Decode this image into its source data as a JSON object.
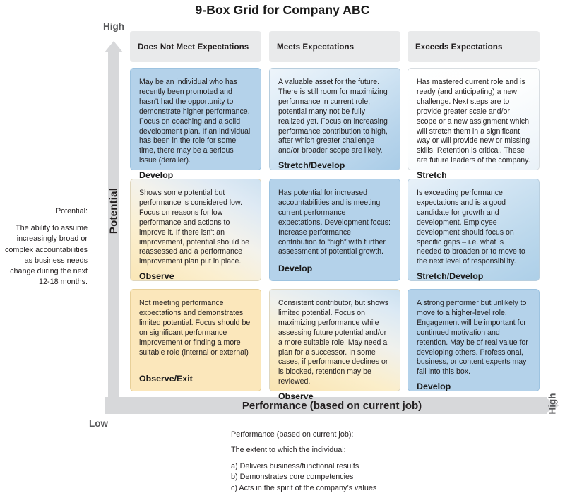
{
  "title": "9-Box Grid for Company ABC",
  "axes": {
    "vertical": {
      "label": "Potential",
      "high_label": "High",
      "low_label": "Low",
      "description_title": "Potential:",
      "description_body": "The ability to assume increasingly broad or complex accountabilities as business needs change during the next 12-18 months."
    },
    "horizontal": {
      "label": "Performance (based on current job)",
      "high_label": "High"
    }
  },
  "column_headers": [
    "Does Not Meet Expectations",
    "Meets Expectations",
    "Exceeds Expectations"
  ],
  "cells": [
    {
      "row": 0,
      "col": 0,
      "body": "May be an individual who has recently been promoted and hasn't had the opportunity to demonstrate higher performance. Focus on coaching and a solid development plan. If an individual has been in the role for some time, there may be a serious issue (derailer).",
      "action": "Develop",
      "fill": "#b4d2ea"
    },
    {
      "row": 0,
      "col": 1,
      "body": "A valuable asset for the future. There is still room for maximizing performance in current role; potential many not be fully realized yet. Focus on increasing performance contribution to high, after which greater challenge and/or broader scope are likely.",
      "action": "Stretch/Develop",
      "fill": "#d7e8f5"
    },
    {
      "row": 0,
      "col": 2,
      "body": "Has mastered current role and is ready (and anticipating) a new challenge. Next steps are to provide greater scale and/or scope or a new assignment which will stretch them in a significant way or will provide new or missing skills. Retention is critical. These are future leaders of the company.",
      "action": "Stretch",
      "fill": "#fdfefe"
    },
    {
      "row": 1,
      "col": 0,
      "body": "Shows some potential but performance is considered low. Focus on reasons for low performance and actions to improve it. If there isn't an improvement, potential should be reassessed and a performance improvement plan put in place.",
      "action": "Observe",
      "fill": "#f5ead0"
    },
    {
      "row": 1,
      "col": 1,
      "body": "Has potential for increased accountabilities and is meeting current performance expectations. Development focus: Increase performance contribution to “high” with further assessment of potential growth.",
      "action": "Develop",
      "fill": "#b4d2ea"
    },
    {
      "row": 1,
      "col": 2,
      "body": "Is exceeding performance expectations and is a good candidate for growth and development. Employee development should focus on specific gaps – i.e. what is needed to broaden or to move to the next level of responsibility.",
      "action": "Stretch/Develop",
      "fill": "#d4e6f4"
    },
    {
      "row": 2,
      "col": 0,
      "body": "Not meeting performance expectations and demonstrates limited potential. Focus should be on significant performance improvement or finding a more suitable role (internal or external)",
      "action": "Observe/Exit",
      "fill": "#fbe7bb"
    },
    {
      "row": 2,
      "col": 1,
      "body": "Consistent contributor, but shows limited potential. Focus on maximizing performance while assessing future potential and/or a more suitable role. May need a plan for a successor. In some cases, if performance declines or is blocked, retention may be reviewed.",
      "action": "Observe",
      "fill": "#f9e4b2"
    },
    {
      "row": 2,
      "col": 2,
      "body": "A strong performer but unlikely to move to a higher-level role. Engagement will be important for continued motivation and retention. May be of real value for developing others. Professional, business, or content experts may fall into this box.",
      "action": "Develop",
      "fill": "#b4d2ea"
    }
  ],
  "footer": {
    "heading": "Performance (based on current job):",
    "subheading": "The extent to which the individual:",
    "items": [
      "a) Delivers business/functional results",
      "b) Demonstrates core competencies",
      "c) Acts in the spirit of the company’s values"
    ]
  },
  "colors": {
    "arrow_gray": "#d7d8da",
    "header_gray": "#e9eaeb",
    "text": "#231f20",
    "muted_text": "#58595b"
  }
}
